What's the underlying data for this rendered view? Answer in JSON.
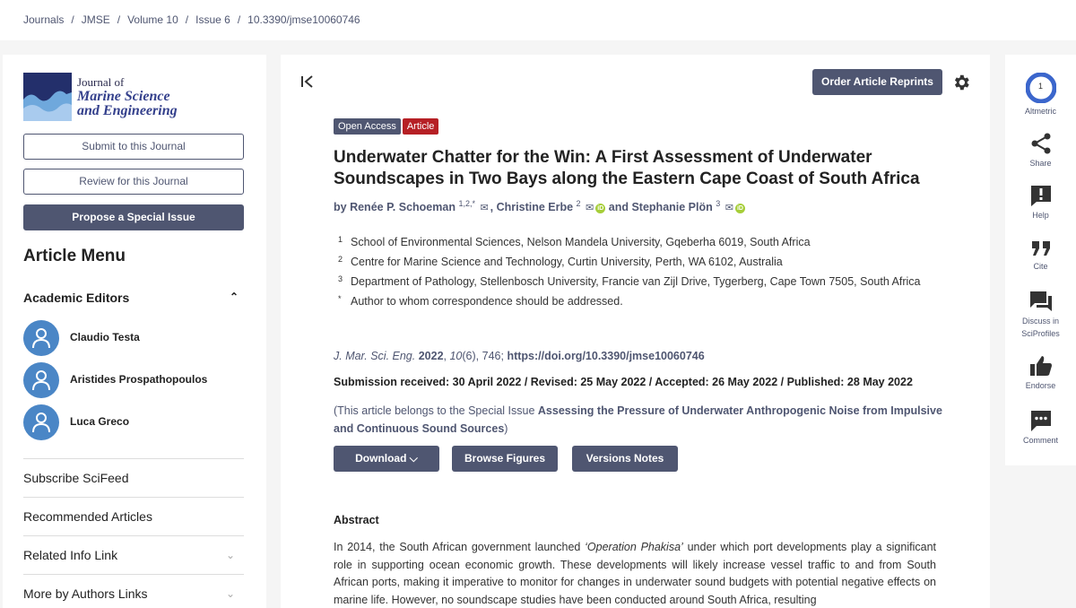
{
  "breadcrumb": {
    "items": [
      "Journals",
      "JMSE",
      "Volume 10",
      "Issue 6",
      "10.3390/jmse10060746"
    ],
    "separator": "/"
  },
  "sidebar": {
    "logo": {
      "line1": "Journal of",
      "line2": "Marine Science",
      "line3": "and Engineering"
    },
    "submit_label": "Submit to this Journal",
    "review_label": "Review for this Journal",
    "propose_label": "Propose a Special Issue",
    "menu_title": "Article Menu",
    "editors_heading": "Academic Editors",
    "editors": [
      "Claudio Testa",
      "Aristides Prospathopoulos",
      "Luca Greco"
    ],
    "links": [
      {
        "label": "Subscribe SciFeed",
        "has_chevron": false
      },
      {
        "label": "Recommended Articles",
        "has_chevron": false
      },
      {
        "label": "Related Info Link",
        "has_chevron": true
      },
      {
        "label": "More by Authors Links",
        "has_chevron": true
      }
    ]
  },
  "article": {
    "reprints_label": "Order Article Reprints",
    "badge_open_access": "Open Access",
    "badge_type": "Article",
    "title": "Underwater Chatter for the Win: A First Assessment of Underwater Soundscapes in Two Bays along the Eastern Cape Coast of South Africa",
    "authors": {
      "prefix": "by",
      "a1": "Renée P. Schoeman",
      "a1_sup": "1,2,*",
      "a2": "Christine Erbe",
      "a2_sup": "2",
      "conj": "and",
      "a3": "Stephanie Plön",
      "a3_sup": "3"
    },
    "affiliations": [
      {
        "num": "1",
        "text": "School of Environmental Sciences, Nelson Mandela University, Gqeberha 6019, South Africa"
      },
      {
        "num": "2",
        "text": "Centre for Marine Science and Technology, Curtin University, Perth, WA 6102, Australia"
      },
      {
        "num": "3",
        "text": "Department of Pathology, Stellenbosch University, Francie van Zijl Drive, Tygerberg, Cape Town 7505, South Africa"
      },
      {
        "num": "*",
        "text": "Author to whom correspondence should be addressed."
      }
    ],
    "citation": {
      "journal": "J. Mar. Sci. Eng.",
      "year": "2022",
      "volume": "10",
      "issue_pages": "(6), 746;",
      "doi": "https://doi.org/10.3390/jmse10060746"
    },
    "dates": "Submission received: 30 April 2022 / Revised: 25 May 2022 / Accepted: 26 May 2022 / Published: 28 May 2022",
    "special_issue": {
      "prefix": "(This article belongs to the Special Issue",
      "name": "Assessing the Pressure of Underwater Anthropogenic Noise from Impulsive and Continuous Sound Sources",
      "suffix": ")"
    },
    "buttons": {
      "download": "Download",
      "browse": "Browse Figures",
      "versions": "Versions Notes"
    },
    "abstract_heading": "Abstract",
    "abstract": {
      "before": "In 2014, the South African government launched ",
      "italic": "‘Operation Phakisa’",
      "after": " under which port developments play a significant role in supporting ocean economic growth. These developments will likely increase vessel traffic to and from South African ports, making it imperative to monitor for changes in underwater sound budgets with potential negative effects on marine life. However, no soundscape studies have been conducted around South Africa, resulting"
    }
  },
  "toolbar": {
    "altmetric_score": "1",
    "items": [
      "Altmetric",
      "Share",
      "Help",
      "Cite",
      "Discuss in SciProfiles",
      "Endorse",
      "Comment"
    ]
  },
  "colors": {
    "brand": "#4f5671",
    "article_badge": "#b62025",
    "orcid": "#a6ce39",
    "avatar": "#4a86c6"
  }
}
